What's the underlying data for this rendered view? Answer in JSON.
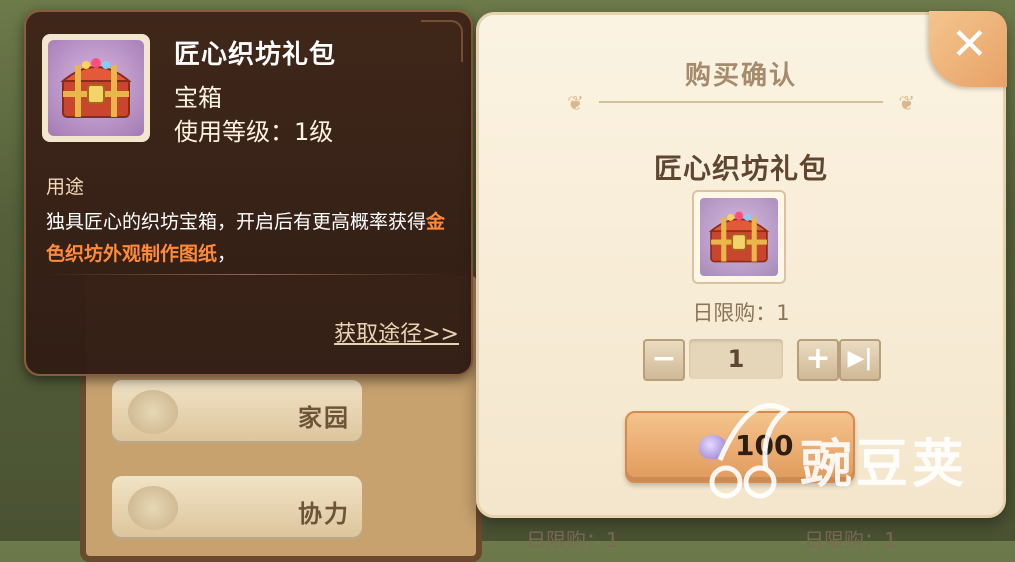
{
  "background": {
    "tabs": [
      {
        "label": "家园"
      },
      {
        "label": "协力"
      }
    ],
    "bottom_labels": [
      "日限购：1",
      "日限购：1"
    ]
  },
  "tooltip": {
    "item_name": "匠心织坊礼包",
    "item_type": "宝箱",
    "use_level": "使用等级：1级",
    "usage_heading": "用途",
    "desc_prefix": "独具匠心的织坊宝箱，开启后有更高概率获得",
    "desc_highlight": "金色织坊外观制作图纸",
    "desc_suffix": "，",
    "obtain_link": "获取途径>>"
  },
  "dialog": {
    "title": "购买确认",
    "close_icon": "close-icon",
    "item_name": "匠心织坊礼包",
    "daily_limit": "日限购：1",
    "quantity": "1",
    "price": "100",
    "currency_icon": "gem-icon"
  },
  "watermark": {
    "text": "豌豆荚"
  },
  "colors": {
    "highlight": "#ff8a3a",
    "buy_button": "#e19a5c",
    "dialog_bg": "#fbf3e2"
  }
}
